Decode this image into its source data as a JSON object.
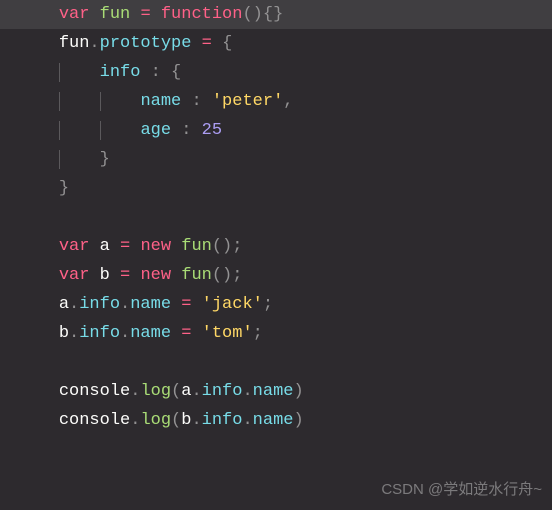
{
  "code": {
    "lines": [
      {
        "indent": 1,
        "hl": true,
        "tokens": [
          {
            "c": "kw",
            "t": "var"
          },
          {
            "c": "def",
            "t": " "
          },
          {
            "c": "fn",
            "t": "fun"
          },
          {
            "c": "def",
            "t": " "
          },
          {
            "c": "op",
            "t": "="
          },
          {
            "c": "def",
            "t": " "
          },
          {
            "c": "kw",
            "t": "function"
          },
          {
            "c": "pn",
            "t": "(){}"
          }
        ]
      },
      {
        "indent": 1,
        "tokens": [
          {
            "c": "id",
            "t": "fun"
          },
          {
            "c": "dot",
            "t": "."
          },
          {
            "c": "prop",
            "t": "prototype"
          },
          {
            "c": "def",
            "t": " "
          },
          {
            "c": "op",
            "t": "="
          },
          {
            "c": "def",
            "t": " "
          },
          {
            "c": "pn",
            "t": "{"
          }
        ]
      },
      {
        "indent": 2,
        "tokens": [
          {
            "c": "prop",
            "t": "info"
          },
          {
            "c": "def",
            "t": " "
          },
          {
            "c": "pn",
            "t": ":"
          },
          {
            "c": "def",
            "t": " "
          },
          {
            "c": "pn",
            "t": "{"
          }
        ]
      },
      {
        "indent": 3,
        "tokens": [
          {
            "c": "prop",
            "t": "name"
          },
          {
            "c": "def",
            "t": " "
          },
          {
            "c": "pn",
            "t": ":"
          },
          {
            "c": "def",
            "t": " "
          },
          {
            "c": "str",
            "t": "'peter'"
          },
          {
            "c": "pn",
            "t": ","
          }
        ]
      },
      {
        "indent": 3,
        "tokens": [
          {
            "c": "prop",
            "t": "age"
          },
          {
            "c": "def",
            "t": " "
          },
          {
            "c": "pn",
            "t": ":"
          },
          {
            "c": "def",
            "t": " "
          },
          {
            "c": "num",
            "t": "25"
          }
        ]
      },
      {
        "indent": 2,
        "tokens": [
          {
            "c": "pn",
            "t": "}"
          }
        ]
      },
      {
        "indent": 1,
        "tokens": [
          {
            "c": "pn",
            "t": "}"
          }
        ]
      },
      {
        "indent": 1,
        "tokens": []
      },
      {
        "indent": 1,
        "tokens": [
          {
            "c": "kw",
            "t": "var"
          },
          {
            "c": "def",
            "t": " "
          },
          {
            "c": "id",
            "t": "a"
          },
          {
            "c": "def",
            "t": " "
          },
          {
            "c": "op",
            "t": "="
          },
          {
            "c": "def",
            "t": " "
          },
          {
            "c": "op",
            "t": "new"
          },
          {
            "c": "def",
            "t": " "
          },
          {
            "c": "fn",
            "t": "fun"
          },
          {
            "c": "pn",
            "t": "();"
          }
        ]
      },
      {
        "indent": 1,
        "tokens": [
          {
            "c": "kw",
            "t": "var"
          },
          {
            "c": "def",
            "t": " "
          },
          {
            "c": "id",
            "t": "b"
          },
          {
            "c": "def",
            "t": " "
          },
          {
            "c": "op",
            "t": "="
          },
          {
            "c": "def",
            "t": " "
          },
          {
            "c": "op",
            "t": "new"
          },
          {
            "c": "def",
            "t": " "
          },
          {
            "c": "fn",
            "t": "fun"
          },
          {
            "c": "pn",
            "t": "();"
          }
        ]
      },
      {
        "indent": 1,
        "tokens": [
          {
            "c": "id",
            "t": "a"
          },
          {
            "c": "dot",
            "t": "."
          },
          {
            "c": "prop",
            "t": "info"
          },
          {
            "c": "dot",
            "t": "."
          },
          {
            "c": "prop",
            "t": "name"
          },
          {
            "c": "def",
            "t": " "
          },
          {
            "c": "op",
            "t": "="
          },
          {
            "c": "def",
            "t": " "
          },
          {
            "c": "str",
            "t": "'jack'"
          },
          {
            "c": "pn",
            "t": ";"
          }
        ]
      },
      {
        "indent": 1,
        "tokens": [
          {
            "c": "id",
            "t": "b"
          },
          {
            "c": "dot",
            "t": "."
          },
          {
            "c": "prop",
            "t": "info"
          },
          {
            "c": "dot",
            "t": "."
          },
          {
            "c": "prop",
            "t": "name"
          },
          {
            "c": "def",
            "t": " "
          },
          {
            "c": "op",
            "t": "="
          },
          {
            "c": "def",
            "t": " "
          },
          {
            "c": "str",
            "t": "'tom'"
          },
          {
            "c": "pn",
            "t": ";"
          }
        ]
      },
      {
        "indent": 1,
        "tokens": []
      },
      {
        "indent": 1,
        "tokens": [
          {
            "c": "id",
            "t": "console"
          },
          {
            "c": "dot",
            "t": "."
          },
          {
            "c": "fn",
            "t": "log"
          },
          {
            "c": "pn",
            "t": "("
          },
          {
            "c": "id",
            "t": "a"
          },
          {
            "c": "dot",
            "t": "."
          },
          {
            "c": "prop",
            "t": "info"
          },
          {
            "c": "dot",
            "t": "."
          },
          {
            "c": "prop",
            "t": "name"
          },
          {
            "c": "pn",
            "t": ")"
          }
        ]
      },
      {
        "indent": 1,
        "tokens": [
          {
            "c": "id",
            "t": "console"
          },
          {
            "c": "dot",
            "t": "."
          },
          {
            "c": "fn",
            "t": "log"
          },
          {
            "c": "pn",
            "t": "("
          },
          {
            "c": "id",
            "t": "b"
          },
          {
            "c": "dot",
            "t": "."
          },
          {
            "c": "prop",
            "t": "info"
          },
          {
            "c": "dot",
            "t": "."
          },
          {
            "c": "prop",
            "t": "name"
          },
          {
            "c": "pn",
            "t": ")"
          }
        ]
      }
    ],
    "indent_unit": "    "
  },
  "watermark": "CSDN @学如逆水行舟~"
}
